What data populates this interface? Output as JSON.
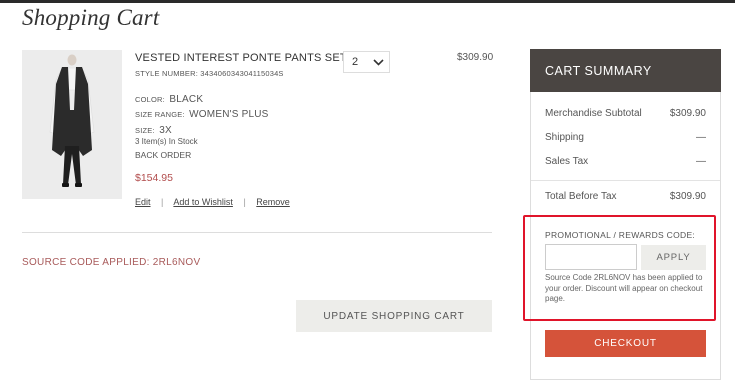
{
  "page": {
    "title": "Shopping Cart"
  },
  "cart_item": {
    "name": "VESTED INTEREST PONTE PANTS SET",
    "style_number": "STYLE NUMBER: 343406034304115034S",
    "color_key": "COLOR:",
    "color_value": "BLACK",
    "size_range_key": "SIZE RANGE:",
    "size_range_value": "WOMEN'S PLUS",
    "size_key": "SIZE:",
    "size_value": "3X",
    "stock": "3 Item(s) In Stock",
    "back_order": "BACK ORDER",
    "price": "$154.95",
    "quantity": "2",
    "line_total": "$309.90",
    "links": {
      "edit": "Edit",
      "wishlist": "Add to Wishlist",
      "remove": "Remove",
      "separator": "|"
    }
  },
  "source_code": "SOURCE CODE APPLIED: 2RL6NOV",
  "update_button": "UPDATE SHOPPING CART",
  "summary": {
    "title": "CART SUMMARY",
    "rows": [
      {
        "label": "Merchandise Subtotal",
        "value": "$309.90"
      },
      {
        "label": "Shipping",
        "value": "—"
      },
      {
        "label": "Sales Tax",
        "value": "—"
      }
    ],
    "total": {
      "label": "Total Before Tax",
      "value": "$309.90"
    },
    "promo": {
      "label": "PROMOTIONAL / REWARDS CODE:",
      "input_value": "",
      "input_placeholder": "",
      "apply_label": "APPLY",
      "note": "Source Code 2RL6NOV has been applied to your order. Discount will appear on checkout page."
    },
    "checkout_label": "CHECKOUT"
  },
  "colors": {
    "accent": "#d5533a",
    "header_bg": "#4a4542",
    "price_red": "#b24d4d",
    "source_code": "#a85a5a",
    "highlight": "#e0142a"
  },
  "icons": {
    "quantity_dropdown": "chevron-down-icon"
  }
}
